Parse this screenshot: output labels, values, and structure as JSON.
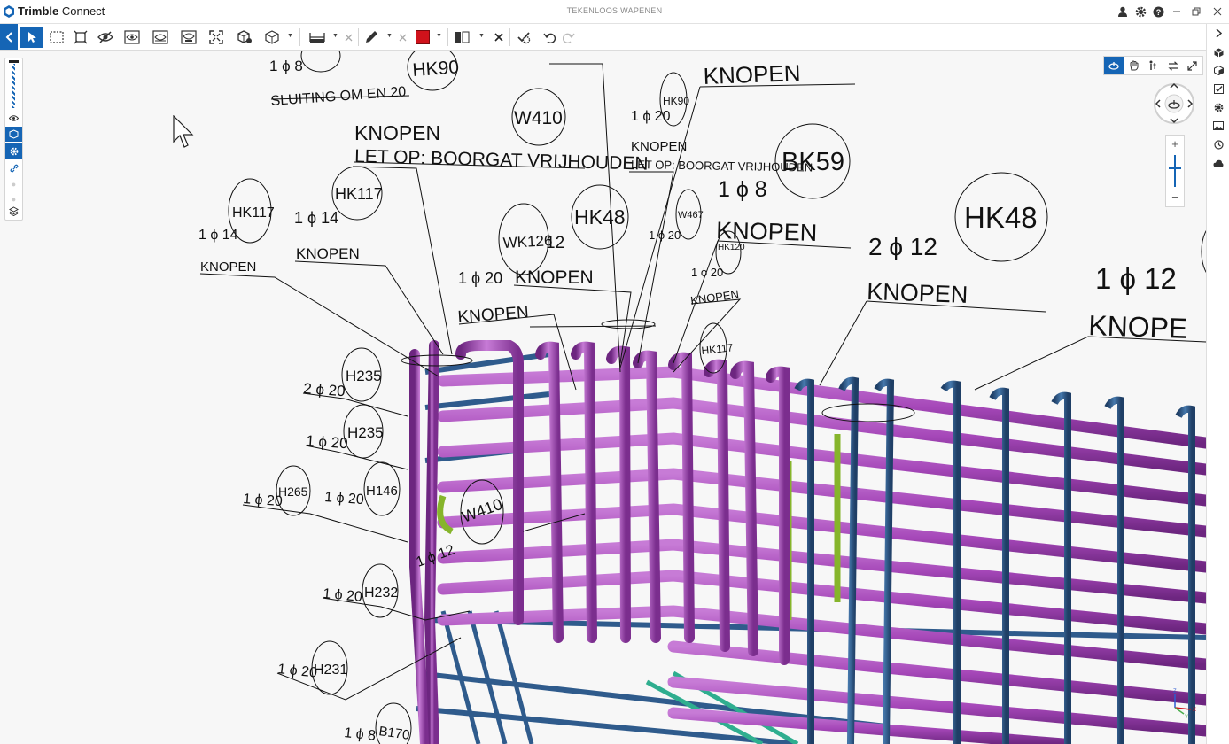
{
  "app": {
    "name_brand": "Trimble",
    "name_product": "Connect",
    "document_title": "TEKENLOOS WAPENEN"
  },
  "window_controls": [
    "user-icon",
    "gear-icon",
    "help-icon",
    "minimize-icon",
    "restore-icon",
    "close-icon"
  ],
  "toolbar": {
    "tools": [
      "collapse-left-icon",
      "select-icon",
      "box-select-icon",
      "fit-selection-icon",
      "hide-icon",
      "show-all-icon",
      "isolate-icon",
      "visibility-icon",
      "fit-view-icon",
      "object-3d-icon",
      "view-cube-icon",
      "measure-icon",
      "clear-measure-icon",
      "markup-pen-icon",
      "clear-markup-icon",
      "color-swatch",
      "section-plane-icon",
      "clear-section-icon",
      "settings-check-icon",
      "undo-icon",
      "redo-icon"
    ],
    "accent": "#1565b5",
    "markup_color": "#d0121b"
  },
  "colors": {
    "rebar_purple": "#a547b8",
    "rebar_blue": "#2f5b8c",
    "rebar_green": "#86b52b",
    "rebar_teal": "#2fae8f"
  },
  "annotations": {
    "labels": [
      "SLUITING OM EN 20",
      "KNOPEN",
      "LET OP: BOORGAT VRIJHOUDEN",
      "KNOPEN",
      "LET OP: BOORGAT VRIJHOUDEN",
      "KNOPEN",
      "KNOPEN",
      "KNOPEN",
      "KNOPEN",
      "KNOPEN",
      "KNOPEN",
      "KNOPEN",
      "KNOPE"
    ],
    "quantities": [
      "1 ϕ 8",
      "1 ϕ 20",
      "1 ϕ 8",
      "1 ϕ 14",
      "1 ϕ 14",
      "1 ϕ 20",
      "1 ϕ 20",
      "1 ϕ 20",
      "2 ϕ 12",
      "1 ϕ 12",
      "2 ϕ 20",
      "1 ϕ 20",
      "1 ϕ 20",
      "1 ϕ 20",
      "1 ϕ 12",
      "1 ϕ 20",
      "1 ϕ 20",
      "1 ϕ 8",
      "12"
    ],
    "marks": [
      "HK90",
      "W410",
      "HK90",
      "BK59",
      "HK117",
      "HK117",
      "HK48",
      "W467",
      "HK48",
      "WK126",
      "HK120",
      "HK117",
      "H235",
      "H235",
      "H265",
      "H146",
      "W410",
      "H232",
      "H231",
      "B170"
    ]
  },
  "sidebar_right": [
    "expand-right-icon",
    "cube-icon",
    "model-icon",
    "todo-icon",
    "settings-icon",
    "image-icon",
    "history-icon",
    "cloud-icon"
  ],
  "sidebar_left": [
    "slider-handle",
    "eye-icon",
    "layer-box-icon",
    "gear-icon",
    "link-icon",
    "disabled-item",
    "disabled-item",
    "stack-icon"
  ],
  "navigation": {
    "modes": [
      "orbit-icon",
      "pan-icon",
      "walk-icon",
      "swap-icon",
      "fullscreen-icon"
    ],
    "zoom_plus": "+",
    "zoom_minus": "−"
  },
  "axes": {
    "x": "X",
    "y": "Y",
    "z": "Z"
  }
}
